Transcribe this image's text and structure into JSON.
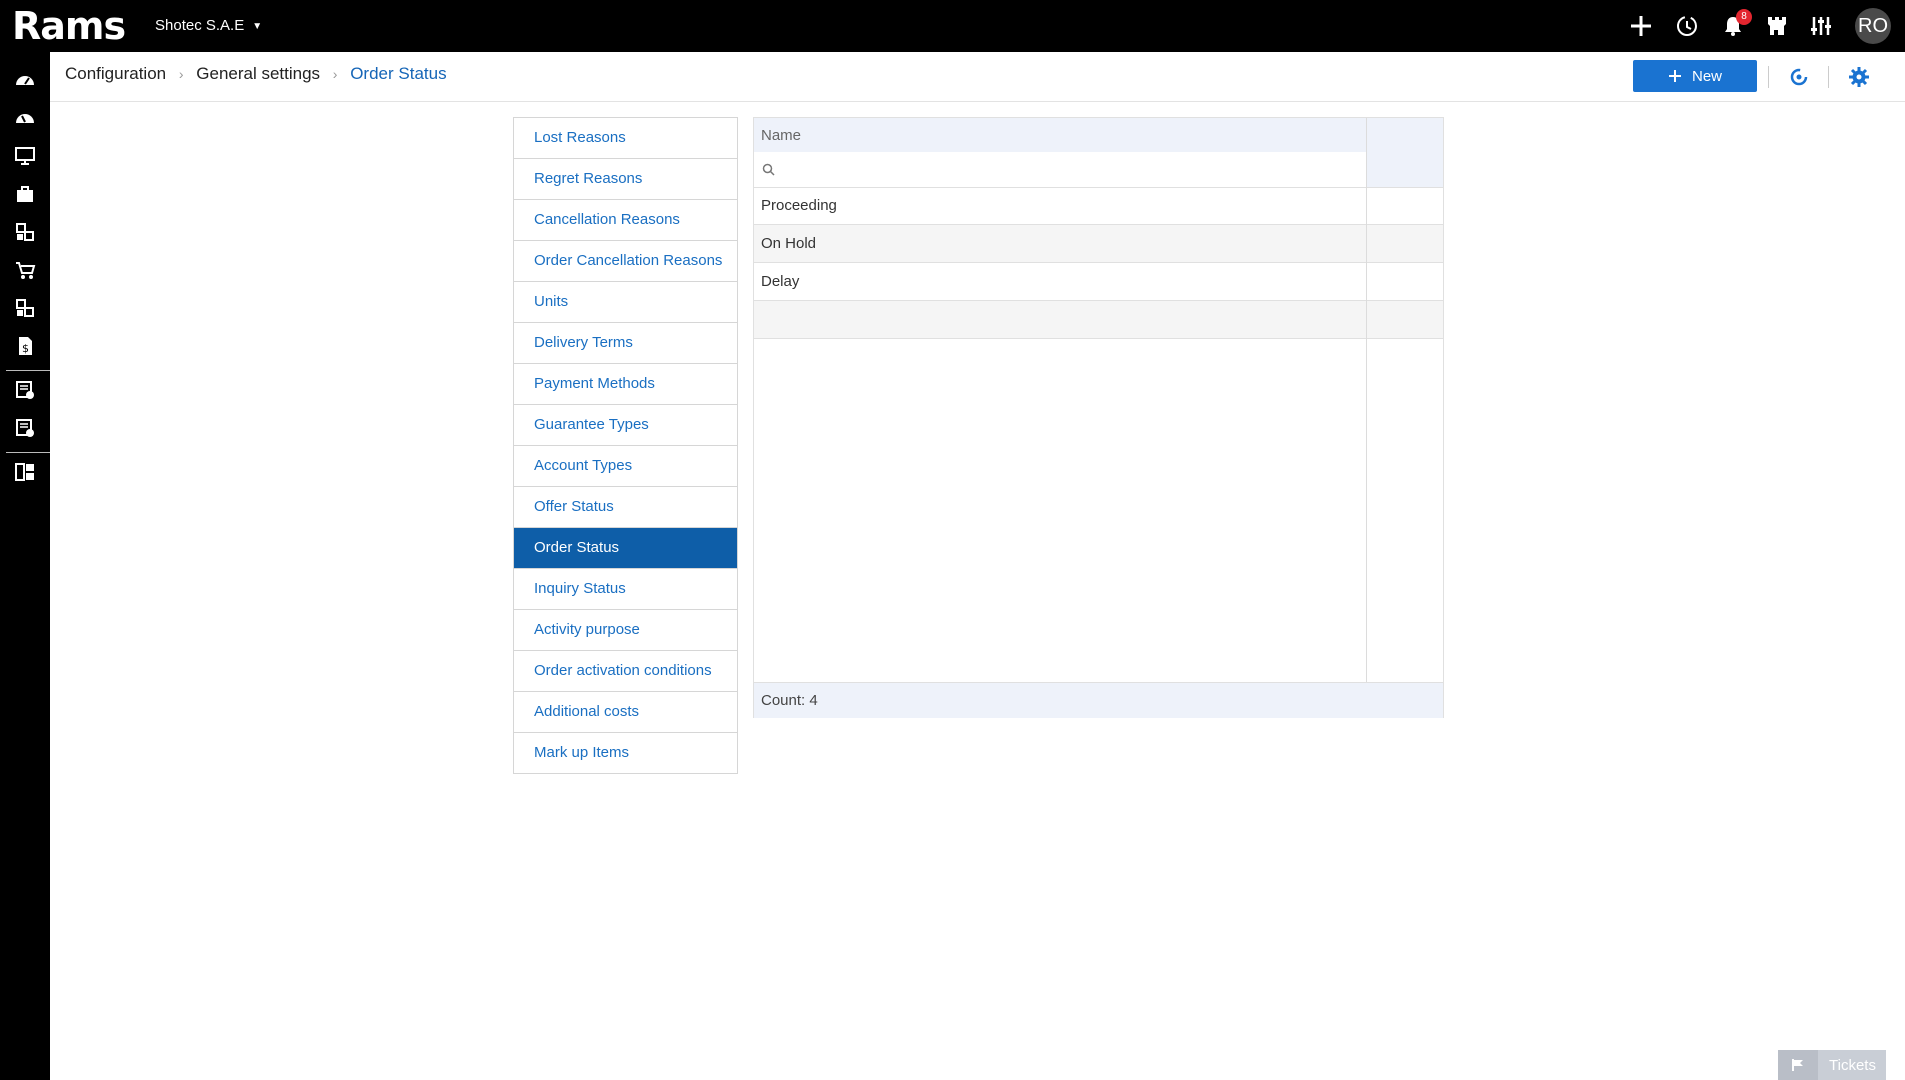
{
  "app": {
    "logo": "Rams",
    "company": "Shotec S.A.E"
  },
  "topbar": {
    "notifications_count": "8",
    "avatar_initials": "RO",
    "icons": [
      "plus-icon",
      "history-icon",
      "bell-icon",
      "castle-icon",
      "sliders-icon"
    ]
  },
  "rail": {
    "icons": [
      "dashboard-icon",
      "dashboard-alt-icon",
      "monitor-icon",
      "briefcase-icon",
      "modules-icon",
      "cart-icon",
      "modules-alt-icon",
      "invoice-dollar-icon",
      "report-check-icon",
      "report-settings-icon",
      "grid-apps-icon"
    ]
  },
  "breadcrumb": {
    "items": [
      "Configuration",
      "General settings",
      "Order Status"
    ]
  },
  "header": {
    "new_label": "New"
  },
  "menu": {
    "items": [
      "Lost Reasons",
      "Regret Reasons",
      "Cancellation Reasons",
      "Order Cancellation Reasons",
      "Units",
      "Delivery Terms",
      "Payment Methods",
      "Guarantee Types",
      "Account Types",
      "Offer Status",
      "Order Status",
      "Inquiry Status",
      "Activity purpose",
      "Order activation conditions",
      "Additional costs",
      "Mark up Items"
    ],
    "active": "Order Status"
  },
  "grid": {
    "column_name": "Name",
    "filter_value": "",
    "rows": [
      "Proceeding",
      "On Hold",
      "Delay",
      ""
    ],
    "footer": "Count: 4"
  },
  "tickets": {
    "label": "Tickets"
  },
  "colors": {
    "accent": "#1a73d1",
    "active_menu": "#0e5ea8",
    "link": "#1a6fc2",
    "badge": "#e3262f"
  }
}
